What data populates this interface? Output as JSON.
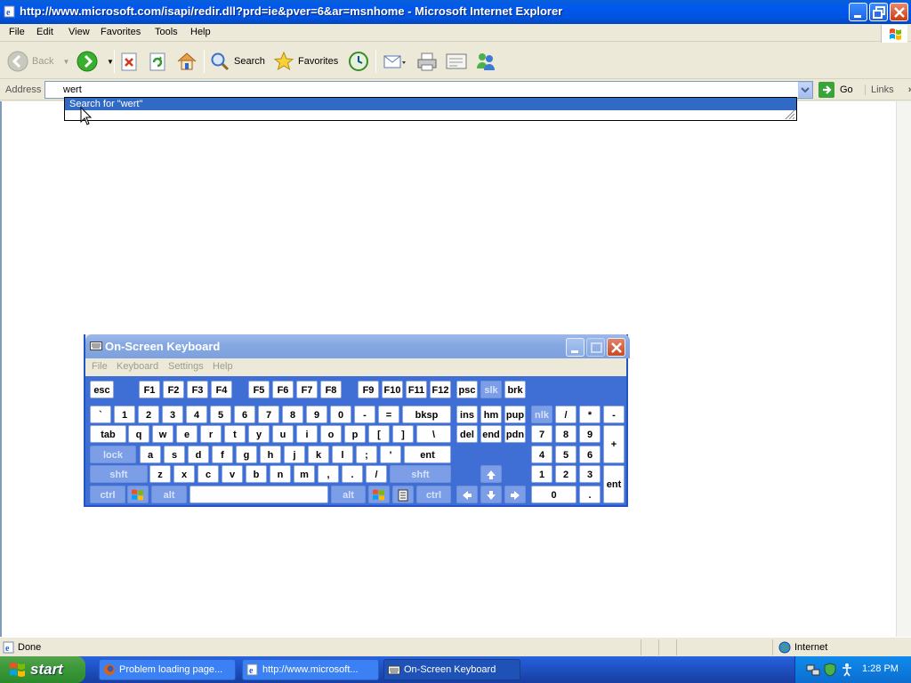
{
  "window": {
    "title": "http://www.microsoft.com/isapi/redir.dll?prd=ie&pver=6&ar=msnhome - Microsoft Internet Explorer"
  },
  "menu": [
    "File",
    "Edit",
    "View",
    "Favorites",
    "Tools",
    "Help"
  ],
  "toolbar": {
    "back": "Back",
    "search": "Search",
    "favorites": "Favorites"
  },
  "address": {
    "label": "Address",
    "value": "wert",
    "go": "Go",
    "links": "Links"
  },
  "autocomplete": {
    "item": "Search for \"wert\""
  },
  "status": {
    "text": "Done",
    "zone": "Internet"
  },
  "taskbar": {
    "start": "start",
    "items": [
      {
        "label": "Problem loading page..."
      },
      {
        "label": "http://www.microsoft..."
      },
      {
        "label": "On-Screen Keyboard"
      }
    ],
    "clock": "1:28 PM"
  },
  "osk": {
    "title": "On-Screen Keyboard",
    "menu": [
      "File",
      "Keyboard",
      "Settings",
      "Help"
    ],
    "row0": [
      "esc",
      "F1",
      "F2",
      "F3",
      "F4",
      "F5",
      "F6",
      "F7",
      "F8",
      "F9",
      "F10",
      "F11",
      "F12",
      "psc",
      "slk",
      "brk"
    ],
    "row1": [
      "`",
      "1",
      "2",
      "3",
      "4",
      "5",
      "6",
      "7",
      "8",
      "9",
      "0",
      "-",
      "=",
      "bksp",
      "ins",
      "hm",
      "pup",
      "nlk",
      "/",
      "*",
      "-"
    ],
    "row2": [
      "tab",
      "q",
      "w",
      "e",
      "r",
      "t",
      "y",
      "u",
      "i",
      "o",
      "p",
      "[",
      "]",
      "\\",
      "del",
      "end",
      "pdn",
      "7",
      "8",
      "9",
      "+"
    ],
    "row3": [
      "lock",
      "a",
      "s",
      "d",
      "f",
      "g",
      "h",
      "j",
      "k",
      "l",
      ";",
      "'",
      "ent",
      "4",
      "5",
      "6"
    ],
    "row4": [
      "shft",
      "z",
      "x",
      "c",
      "v",
      "b",
      "n",
      "m",
      ",",
      ".",
      "/",
      "shft",
      "1",
      "2",
      "3",
      "ent"
    ],
    "row5": [
      "ctrl",
      "alt",
      "alt",
      "ctrl",
      "0",
      "."
    ]
  },
  "colors": {
    "title_blue": "#0054e3",
    "osk_body": "#3f6fd4",
    "selection": "#316ac5",
    "start_green": "#3c9a3a"
  }
}
